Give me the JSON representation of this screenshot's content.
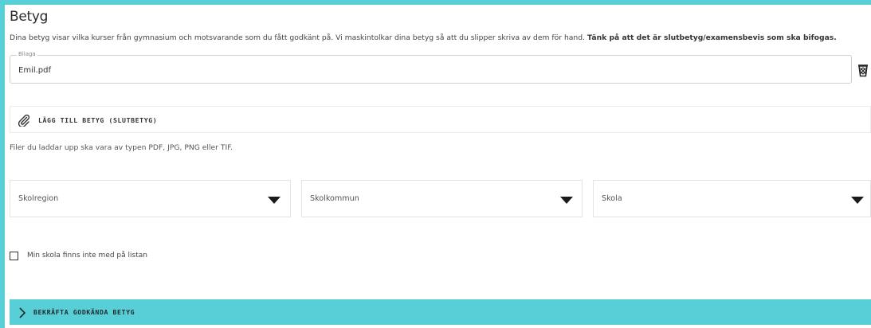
{
  "section": {
    "title": "Betyg",
    "description_main": "Dina betyg visar vilka kurser från gymnasium och motsvarande som du fått godkänt på. Vi maskintolkar dina betyg så att du slipper skriva av dem för hand. ",
    "description_bold": "Tänk på att det är slutbetyg/examensbevis som ska bifogas."
  },
  "attachment": {
    "legend": "Bilaga",
    "value": "Emil.pdf",
    "remove_icon": "trash-icon"
  },
  "add_grade": {
    "label": "LÄGG TILL BETYG (SLUTBETYG)",
    "icon": "paperclip-icon"
  },
  "file_hint": "Filer du laddar upp ska vara av typen PDF, JPG, PNG eller TIF.",
  "selects": [
    {
      "placeholder": "Skolregion"
    },
    {
      "placeholder": "Skolkommun"
    },
    {
      "placeholder": "Skola"
    }
  ],
  "school_missing": {
    "label": "Min skola finns inte med på listan",
    "checked": false
  },
  "confirm_accordion": {
    "label": "BEKRÄFTA GODKÄNDA BETYG",
    "icon": "chevron-right-icon"
  },
  "colors": {
    "accent": "#58cfd6"
  }
}
